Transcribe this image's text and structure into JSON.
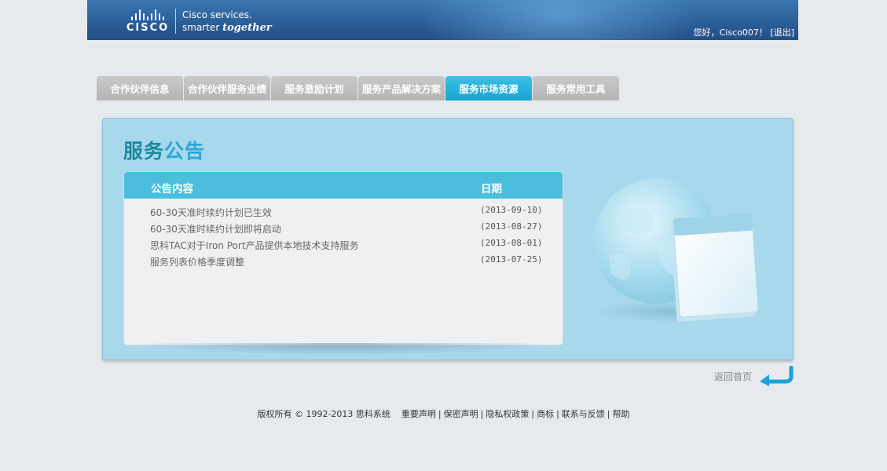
{
  "header": {
    "logo_text": "CISCO",
    "tagline_line1": "Cisco services.",
    "tagline_line2_a": "smarter",
    "tagline_line2_b": "together",
    "greeting": "您好，Cisco007！",
    "logout_label": "[退出]"
  },
  "tabs": [
    {
      "label": "合作伙伴信息",
      "active": false
    },
    {
      "label": "合作伙伴服务业绩",
      "active": false
    },
    {
      "label": "服务激励计划",
      "active": false
    },
    {
      "label": "服务产品解决方案",
      "active": false
    },
    {
      "label": "服务市场资源",
      "active": true
    },
    {
      "label": "服务常用工具",
      "active": false
    }
  ],
  "panel": {
    "title_part1": "服务",
    "title_part2": "公告",
    "colors": {
      "title1": "#1b8a9e",
      "title2": "#2aa8d5",
      "tab_active": "#18a3d2",
      "head": "#4bbedd"
    }
  },
  "notices": {
    "col_content": "公告内容",
    "col_date": "日期",
    "rows": [
      {
        "title": "60-30天准时续约计划已生效",
        "date": "(2013-09-10)"
      },
      {
        "title": "60-30天准时续约计划即将启动",
        "date": "(2013-08-27)"
      },
      {
        "title": "思科TAC对于Iron Port产品提供本地技术支持服务",
        "date": "(2013-08-01)"
      },
      {
        "title": "服务列表价格季度调整",
        "date": "(2013-07-25)"
      }
    ]
  },
  "back_home": {
    "label": "返回首页",
    "icon": "return-arrow-icon"
  },
  "footer": {
    "copyright": "版权所有 © 1992-2013 思科系统",
    "links": [
      "重要声明",
      "保密声明",
      "隐私权政策",
      "商标",
      "联系与反馈",
      "帮助"
    ]
  }
}
